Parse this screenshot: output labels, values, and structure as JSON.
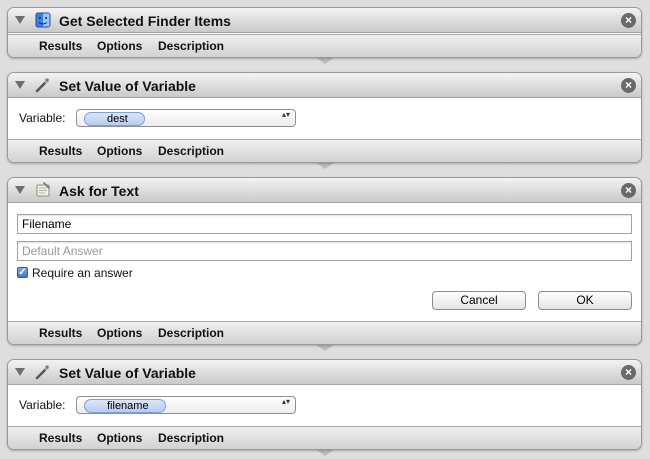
{
  "close_glyph": "×",
  "popup_arrows": "▴▾",
  "check_glyph": "✓",
  "actions": [
    {
      "title": "Get Selected Finder Items",
      "icon": "finder-icon",
      "tabs": {
        "results": "Results",
        "options": "Options",
        "description": "Description"
      }
    },
    {
      "title": "Set Value of Variable",
      "icon": "variable-wand-icon",
      "variable_label": "Variable:",
      "variable_value": "dest",
      "tabs": {
        "results": "Results",
        "options": "Options",
        "description": "Description"
      }
    },
    {
      "title": "Ask for Text",
      "icon": "ask-text-icon",
      "question_value": "Filename",
      "default_answer_placeholder": "Default Answer",
      "require_answer_label": "Require an answer",
      "require_answer_checked": true,
      "cancel_label": "Cancel",
      "ok_label": "OK",
      "tabs": {
        "results": "Results",
        "options": "Options",
        "description": "Description"
      }
    },
    {
      "title": "Set Value of Variable",
      "icon": "variable-wand-icon",
      "variable_label": "Variable:",
      "variable_value": "filename",
      "tabs": {
        "results": "Results",
        "options": "Options",
        "description": "Description"
      }
    }
  ],
  "colors": {
    "token_fill": "#c9d8f5",
    "token_border": "#7f9fd6",
    "checkbox_fill": "#3d74d4"
  }
}
